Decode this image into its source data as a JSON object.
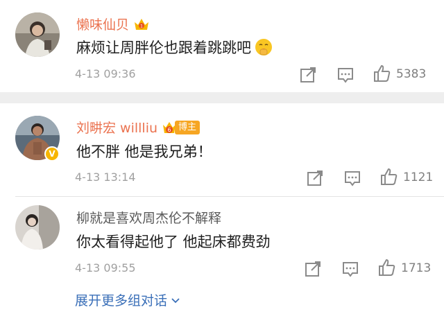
{
  "comments": [
    {
      "username": "懒味仙贝",
      "text": "麻烦让周胖伦也跟着跳跳吧",
      "time": "4-13 09:36",
      "likes": "5383",
      "emoji": "shushing-face-emoji"
    },
    {
      "username": "刘畊宏 willliu",
      "badge_level": "6",
      "badge_tag": "博主",
      "verified_badge": "V",
      "text": "他不胖 他是我兄弟！",
      "time": "4-13 13:14",
      "likes": "1121"
    },
    {
      "username": "柳就是喜欢周杰伦不解释",
      "text": "你太看得起他了 他起床都费劲",
      "time": "4-13 09:55",
      "likes": "1713"
    }
  ],
  "more_replies_label": "展开更多组对话",
  "colors": {
    "username_orange": "#eb7350",
    "link_blue": "#3a6fb8",
    "meta_gray": "#a0a0a0",
    "badge_gold": "#f6a623"
  },
  "icons": [
    "share-icon",
    "comment-icon",
    "like-icon",
    "chevron-down-icon",
    "vip-crown-icon"
  ]
}
